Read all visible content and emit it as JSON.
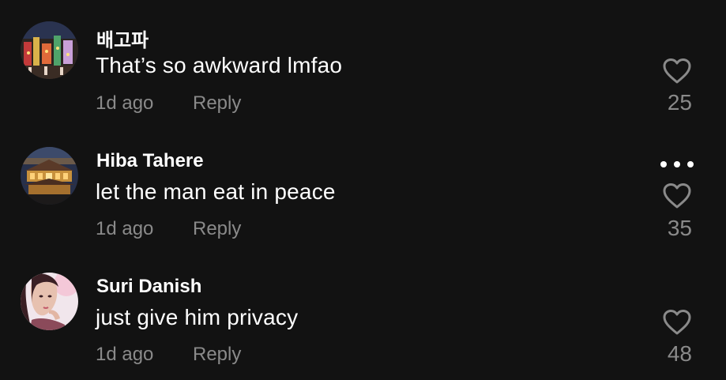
{
  "comments": [
    {
      "username": "배고파",
      "text": "That’s so awkward lmfao",
      "time": "1d ago",
      "reply_label": "Reply",
      "likes": "25",
      "avatar_icon": "city-night-avatar",
      "has_more_menu": false
    },
    {
      "username": "Hiba Tahere",
      "text": "let the man eat in peace",
      "time": "1d ago",
      "reply_label": "Reply",
      "likes": "35",
      "avatar_icon": "temple-night-avatar",
      "has_more_menu": true
    },
    {
      "username": "Suri Danish",
      "text": "just give him privacy",
      "time": "1d ago",
      "reply_label": "Reply",
      "likes": "48",
      "avatar_icon": "portrait-avatar",
      "has_more_menu": false
    }
  ],
  "colors": {
    "background": "#121212",
    "primary_text": "#ffffff",
    "secondary_text": "#8a8a8a"
  }
}
